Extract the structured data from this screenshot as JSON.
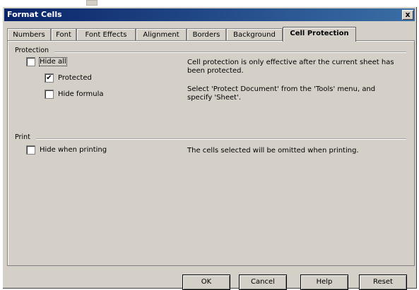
{
  "window": {
    "title": "Format Cells",
    "close_glyph": "x"
  },
  "tabs": [
    {
      "label": "Numbers"
    },
    {
      "label": "Font"
    },
    {
      "label": "Font Effects"
    },
    {
      "label": "Alignment"
    },
    {
      "label": "Borders"
    },
    {
      "label": "Background"
    },
    {
      "label": "Cell Protection",
      "active": true
    }
  ],
  "protection": {
    "section_label": "Protection",
    "hide_all": {
      "label": "Hide all",
      "checked": false
    },
    "protected": {
      "label": "Protected",
      "checked": true,
      "check_glyph": "✔"
    },
    "hide_formula": {
      "label": "Hide formula",
      "checked": false
    },
    "info1": "Cell protection is only effective after the current sheet has been protected.",
    "info2": "Select 'Protect Document' from the 'Tools' menu, and specify 'Sheet'."
  },
  "print": {
    "section_label": "Print",
    "hide_when_printing": {
      "label": "Hide when printing",
      "checked": false
    },
    "info": "The cells selected will be omitted when printing."
  },
  "buttons": {
    "ok": "OK",
    "cancel": "Cancel",
    "help": "Help",
    "reset": "Reset"
  }
}
